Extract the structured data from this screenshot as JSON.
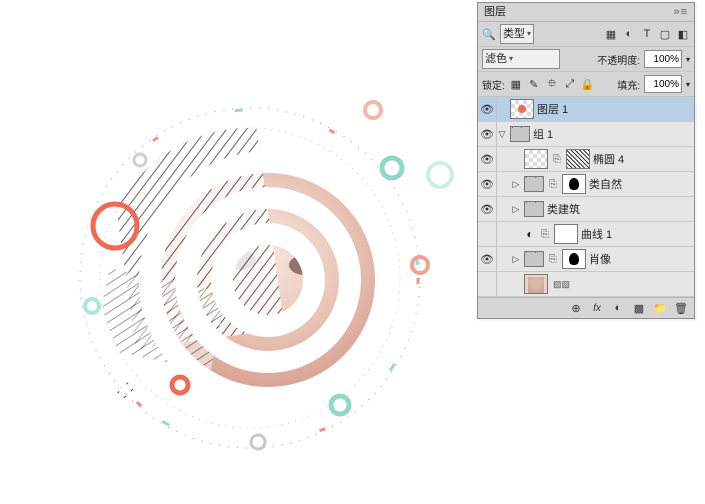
{
  "panel": {
    "title": "图层",
    "flyout": "»≡",
    "search_icon": "🔍",
    "kind_label": "类型",
    "filter_icons": [
      "▦",
      "◐",
      "T",
      "▢",
      "◧"
    ],
    "blend_mode": "滤色",
    "opacity_label": "不透明度:",
    "opacity_value": "100%",
    "lock_label": "锁定:",
    "lock_icons": [
      "▦",
      "✎",
      "⯐",
      "⤢",
      "🔒"
    ],
    "fill_label": "填充:",
    "fill_value": "100%",
    "footer_icons": [
      "⊕",
      "fx",
      "◐",
      "▩",
      "📁",
      "🗑"
    ]
  },
  "layers": [
    {
      "indent": 0,
      "eye": true,
      "twisty": "",
      "thumbs": [
        {
          "cls": "checker",
          "dot": true
        }
      ],
      "name": "图层 1",
      "selected": true
    },
    {
      "indent": 0,
      "eye": true,
      "twisty": "▽",
      "thumbs": [
        {
          "cls": "folder"
        }
      ],
      "name": "组 1"
    },
    {
      "indent": 1,
      "eye": true,
      "twisty": "",
      "thumbs": [
        {
          "cls": "checker"
        },
        {
          "link": true
        },
        {
          "cls": "scratch"
        }
      ],
      "name": "椭圆 4"
    },
    {
      "indent": 1,
      "eye": true,
      "twisty": "▷",
      "thumbs": [
        {
          "cls": "folder"
        },
        {
          "link": true
        },
        {
          "cls": "mask"
        }
      ],
      "name": "类自然"
    },
    {
      "indent": 1,
      "eye": true,
      "twisty": "▷",
      "thumbs": [
        {
          "cls": "folder"
        }
      ],
      "name": "类建筑"
    },
    {
      "indent": 1,
      "eye": false,
      "twisty": "",
      "thumbs": [
        {
          "adj": true
        },
        {
          "link": true
        },
        {
          "cls": "white"
        }
      ],
      "name": "曲线 1"
    },
    {
      "indent": 1,
      "eye": true,
      "twisty": "▷",
      "thumbs": [
        {
          "cls": "folder"
        },
        {
          "link": true
        },
        {
          "cls": "mask"
        }
      ],
      "name": "肖像"
    },
    {
      "indent": 1,
      "eye": false,
      "twisty": "",
      "thumbs": [
        {
          "cls": "portrait"
        },
        {
          "bits": true
        }
      ],
      "name": ""
    }
  ]
}
